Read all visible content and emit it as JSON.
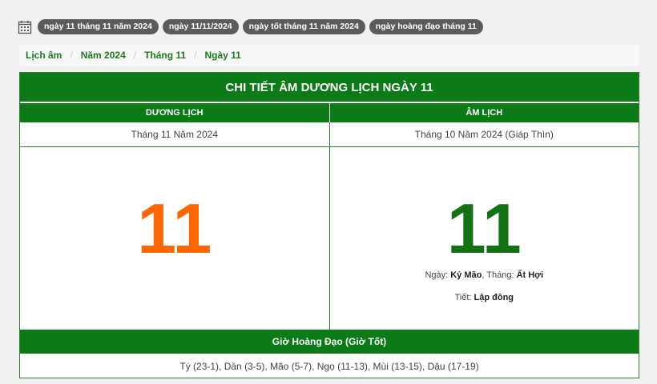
{
  "tags": [
    "ngày 11 tháng 11 năm 2024",
    "ngày 11/11/2024",
    "ngày tốt tháng 11 năm 2024",
    "ngày hoàng đạo tháng 11"
  ],
  "breadcrumb": [
    "Lịch âm",
    "Năm 2024",
    "Tháng 11",
    "Ngày 11"
  ],
  "card": {
    "title": "CHI TIẾT ÂM DƯƠNG LỊCH NGÀY 11",
    "solar": {
      "header": "DƯƠNG LỊCH",
      "month_year": "Tháng 11 Năm 2024",
      "day": "11",
      "color": "#ff6600"
    },
    "lunar": {
      "header": "ÂM LỊCH",
      "month_year": "Tháng 10 Năm 2024 (Giáp Thìn)",
      "day": "11",
      "color": "#137013",
      "day_label": "Ngày: ",
      "day_name": "Kỷ Mão",
      "month_label": ", Tháng: ",
      "month_name": "Ất Hợi",
      "term_label": "Tiết: ",
      "term_name": "Lập đông"
    },
    "good_hours": {
      "header": "Giờ Hoàng Đạo (Giờ Tốt)",
      "list": "Tý (23-1), Dần (3-5), Mão (5-7), Ngọ (11-13), Mùi (13-15), Dậu (17-19)"
    }
  },
  "colors": {
    "brand_green": "#0b7a17",
    "tag_bg": "#5b5b5b"
  },
  "icons": {
    "tagbar": "calendar-icon"
  }
}
